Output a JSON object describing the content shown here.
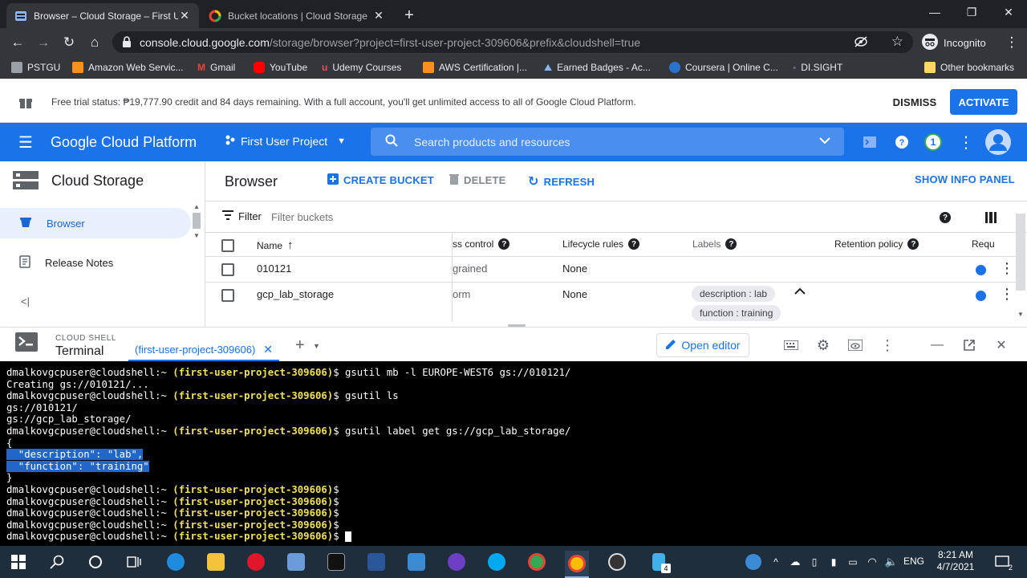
{
  "browser": {
    "tabs": [
      {
        "title": "Browser – Cloud Storage – First U",
        "active": true
      },
      {
        "title": "Bucket locations  |  Cloud Storage",
        "active": false
      }
    ],
    "url_host": "console.cloud.google.com",
    "url_path": "/storage/browser?project=first-user-project-309606&prefix&cloudshell=true",
    "incognito_label": "Incognito",
    "bookmarks": [
      "PSTGU",
      "Amazon Web Servic...",
      "Gmail",
      "YouTube",
      "Udemy Courses",
      "AWS Certification |...",
      "Earned Badges - Ac...",
      "Coursera | Online C...",
      "DI.SIGHT",
      "Other bookmarks"
    ]
  },
  "trial_banner": {
    "text": "Free trial status: ₱19,777.90 credit and 84 days remaining. With a full account, you'll get unlimited access to all of Google Cloud Platform.",
    "dismiss": "DISMISS",
    "activate": "ACTIVATE"
  },
  "gcp_header": {
    "title": "Google Cloud Platform",
    "project": "First User Project",
    "search_placeholder": "Search products and resources",
    "notification_count": "1"
  },
  "leftnav": {
    "title": "Cloud Storage",
    "items": [
      {
        "label": "Browser",
        "selected": true
      },
      {
        "label": "Release Notes",
        "selected": false
      }
    ],
    "collapse": "<|"
  },
  "main": {
    "title": "Browser",
    "create_bucket": "CREATE BUCKET",
    "delete": "DELETE",
    "refresh": "REFRESH",
    "show_info_panel": "SHOW INFO PANEL",
    "filter_label": "Filter",
    "filter_placeholder": "Filter buckets",
    "columns": {
      "name": "Name",
      "access_control": "ss control",
      "lifecycle": "Lifecycle rules",
      "labels": "Labels",
      "retention": "Retention policy",
      "requester": "Requ"
    },
    "rows": [
      {
        "name": "010121",
        "access": "grained",
        "lifecycle": "None",
        "labels": []
      },
      {
        "name": "gcp_lab_storage",
        "access": "orm",
        "lifecycle": "None",
        "labels": [
          "description : lab",
          "function : training"
        ]
      }
    ]
  },
  "cloud_shell": {
    "section": "CLOUD SHELL",
    "terminal_label": "Terminal",
    "project_tab": "(first-user-project-309606)",
    "open_editor": "Open editor",
    "prompt_user": "dmalkovgcpuser@cloudshell:~",
    "prompt_project": "(first-user-project-309606)",
    "lines": [
      {
        "type": "prompt",
        "cmd": "gsutil mb -l EUROPE-WEST6 gs://010121/"
      },
      {
        "type": "out",
        "text": "Creating gs://010121/..."
      },
      {
        "type": "prompt",
        "cmd": "gsutil ls"
      },
      {
        "type": "out",
        "text": "gs://010121/"
      },
      {
        "type": "out",
        "text": "gs://gcp_lab_storage/"
      },
      {
        "type": "prompt",
        "cmd": "gsutil label get gs://gcp_lab_storage/"
      },
      {
        "type": "out",
        "text": "{"
      },
      {
        "type": "sel",
        "text": "  \"description\": \"lab\","
      },
      {
        "type": "sel",
        "text": "  \"function\": \"training\""
      },
      {
        "type": "out",
        "text": "}"
      },
      {
        "type": "prompt",
        "cmd": ""
      },
      {
        "type": "prompt",
        "cmd": ""
      },
      {
        "type": "prompt",
        "cmd": ""
      },
      {
        "type": "prompt",
        "cmd": ""
      },
      {
        "type": "prompt_cursor",
        "cmd": ""
      }
    ]
  },
  "taskbar": {
    "lang": "ENG",
    "time": "8:21 AM",
    "date": "4/7/2021",
    "badge": "4",
    "notif": "2"
  },
  "colors": {
    "gcp_blue": "#1a73e8",
    "chrome_dark": "#202124",
    "terminal_project": "#f1e05a",
    "selection": "#2166c9"
  }
}
